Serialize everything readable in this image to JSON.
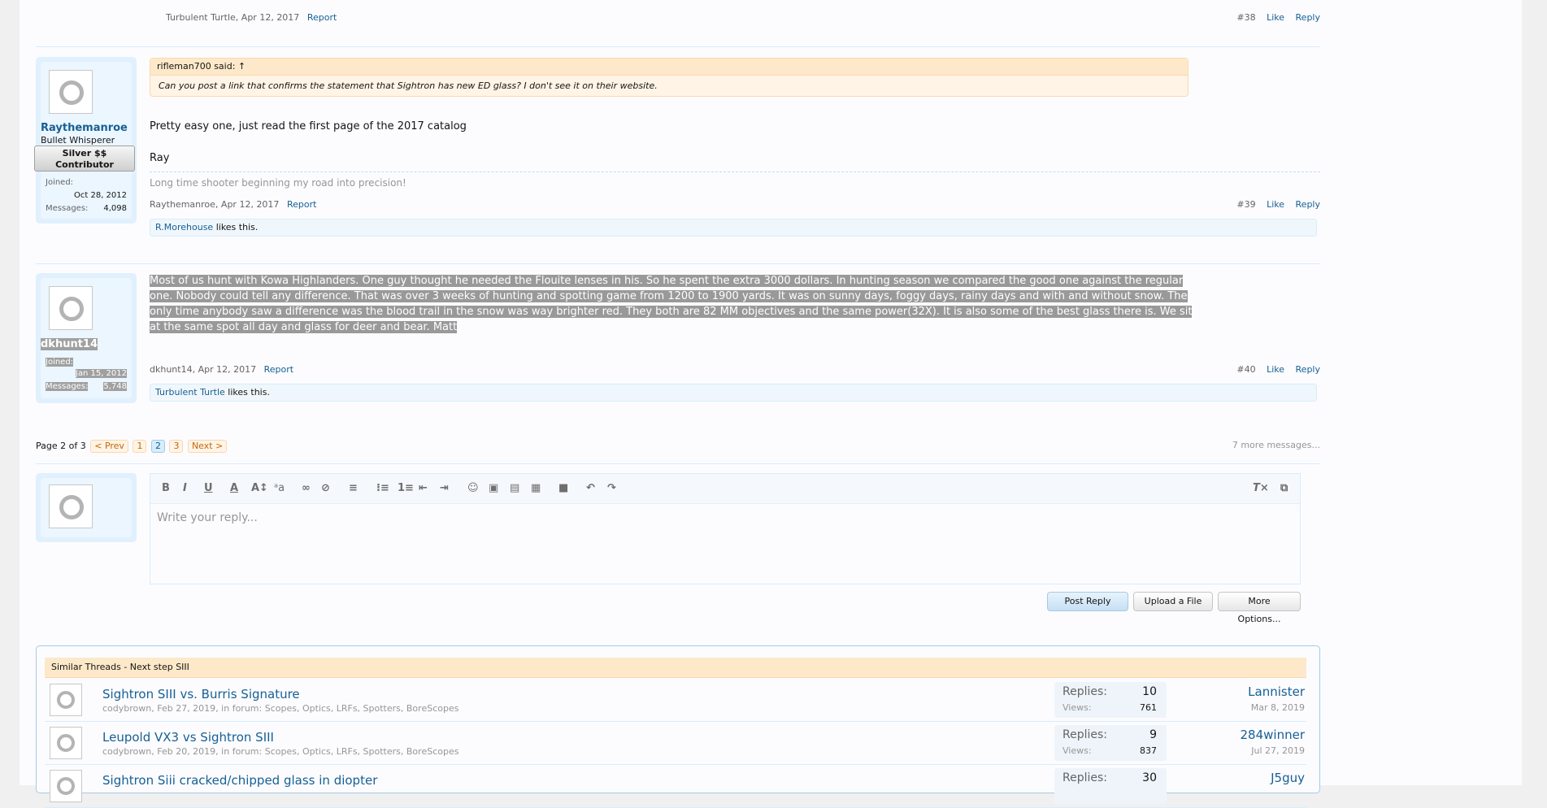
{
  "post38": {
    "author": "Turbulent Turtle",
    "date": "Apr 12, 2017",
    "report": "Report",
    "num": "#38",
    "like": "Like",
    "reply": "Reply"
  },
  "post39": {
    "username": "Raythemanroe",
    "user_title": "Bullet Whisperer",
    "banner": "Silver $$ Contributor",
    "joined_label": "Joined:",
    "joined": "Oct 28, 2012",
    "messages_label": "Messages:",
    "messages": "4,098",
    "quote_author": "rifleman700 said: ↑",
    "quote_text": "Can you post a link that confirms the statement that Sightron has new ED glass? I don't see it on their website.",
    "body_line1": "Pretty easy one, just read the first page of the 2017 catalog",
    "body_line2": "Ray",
    "signature": "Long time shooter beginning my road into precision!",
    "author": "Raythemanroe",
    "date": "Apr 12, 2017",
    "report": "Report",
    "num": "#39",
    "like": "Like",
    "reply": "Reply",
    "likes_user": "R.Morehouse",
    "likes_text": "likes this."
  },
  "post40": {
    "username": "dkhunt14",
    "joined_label": "Joined:",
    "joined": "Jan 15, 2012",
    "messages_label": "Messages:",
    "messages": "5,748",
    "body_lines": [
      "Most of us hunt with Kowa Highlanders. One guy thought he needed the Flouite lenses in his. So he spent the extra 3000 dollars. In hunting season we compared the good one against the regular",
      "one. Nobody could tell any difference. That was over 3 weeks of hunting and spotting game from 1200 to 1900 yards. It was on sunny days, foggy days, rainy days and with and without snow. The",
      "only time anybody saw a difference was the blood trail in the snow was way brighter red. They both are 82 MM objectives and the same power(32X). It is also some of the best glass there is. We sit",
      "at the same spot all day and glass for deer and bear. Matt"
    ],
    "author": "dkhunt14",
    "date": "Apr 12, 2017",
    "report": "Report",
    "num": "#40",
    "like": "Like",
    "reply": "Reply",
    "likes_user": "Turbulent Turtle",
    "likes_text": "likes this."
  },
  "pagination": {
    "label": "Page 2 of 3",
    "prev": "< Prev",
    "pages": [
      "1",
      "2",
      "3"
    ],
    "current": "2",
    "next": "Next >",
    "more": "7 more messages..."
  },
  "reply": {
    "placeholder": "Write your reply...",
    "toolbar_icons": [
      "bold-icon",
      "italic-icon",
      "underline-icon",
      "font-color-icon",
      "font-size-icon",
      "font-family-icon",
      "link-icon",
      "unlink-icon",
      "align-icon",
      "bullet-list-icon",
      "numbered-list-icon",
      "outdent-icon",
      "indent-icon",
      "smilie-icon",
      "image-icon",
      "media-icon",
      "quote-icon",
      "save-draft-icon",
      "undo-icon",
      "redo-icon",
      "remove-format-icon",
      "toggle-bbcode-icon"
    ],
    "post_button": "Post Reply",
    "upload_button": "Upload a File",
    "more_button": "More Options..."
  },
  "similar": {
    "title": "Similar Threads - Next step SIII",
    "threads": [
      {
        "title": "Sightron SIII vs. Burris Signature",
        "meta": "codybrown, Feb 27, 2019, in forum: Scopes, Optics, LRFs, Spotters, BoreScopes",
        "replies_label": "Replies:",
        "replies": "10",
        "views_label": "Views:",
        "views": "761",
        "last_user": "Lannister",
        "last_date": "Mar 8, 2019"
      },
      {
        "title": "Leupold VX3 vs Sightron SIII",
        "meta": "codybrown, Feb 20, 2019, in forum: Scopes, Optics, LRFs, Spotters, BoreScopes",
        "replies_label": "Replies:",
        "replies": "9",
        "views_label": "Views:",
        "views": "837",
        "last_user": "284winner",
        "last_date": "Jul 27, 2019"
      },
      {
        "title": "Sightron Siii cracked/chipped glass in diopter",
        "meta": "",
        "replies_label": "Replies:",
        "replies": "30",
        "views_label": "",
        "views": "",
        "last_user": "J5guy",
        "last_date": ""
      }
    ]
  },
  "colors": {
    "link": "#176093",
    "quote_bg": "#fff4e5",
    "userblock_bg": "#e1f0fd",
    "selection": "#999999"
  }
}
